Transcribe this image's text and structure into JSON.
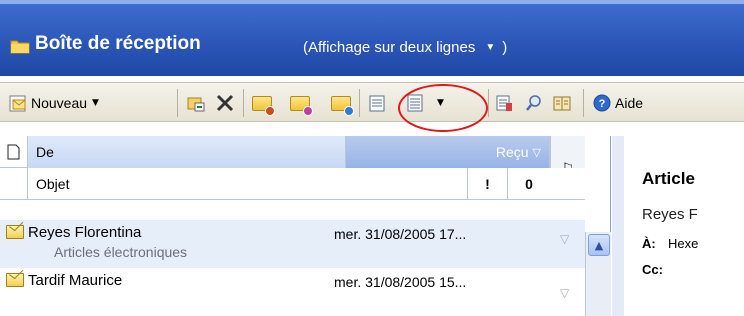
{
  "header": {
    "folder_icon": "folder-icon",
    "title": "Boîte de réception",
    "view_mode": "(Affichage sur deux lignes",
    "view_mode_close": ")"
  },
  "toolbar": {
    "new_label": "Nouveau",
    "help_label": "Aide"
  },
  "list": {
    "columns": {
      "from": "De",
      "received": "Reçu",
      "subject": "Objet",
      "importance": "!",
      "attachment": "0"
    },
    "rows": [
      {
        "sender": "Reyes Florentina",
        "subject": "Articles électroniques",
        "date": "mer. 31/08/2005 17..."
      },
      {
        "sender": "Tardif Maurice",
        "subject": "",
        "date": "mer. 31/08/2005 15..."
      }
    ]
  },
  "reading": {
    "title": "Article",
    "from": "Reyes F",
    "to_label": "À:",
    "to_value": "Hexe",
    "cc_label": "Cc:"
  },
  "colors": {
    "header_blue": "#2a55b7",
    "annotation_red": "#e21818",
    "selected_row": "#e6eef9"
  }
}
